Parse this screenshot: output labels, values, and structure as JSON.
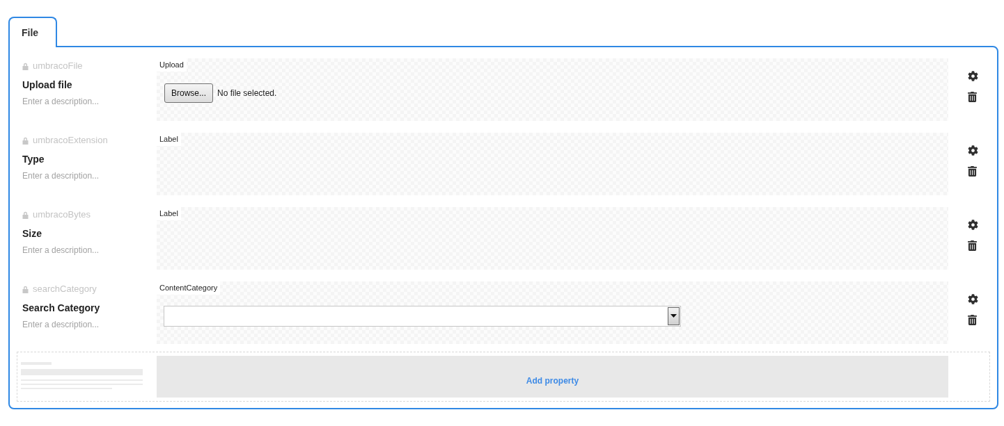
{
  "tabs": [
    {
      "label": "File",
      "selected": true
    }
  ],
  "properties": [
    {
      "alias": "umbracoFile",
      "locked": true,
      "name": "Upload file",
      "description": {
        "placeholder": "Enter a description..."
      },
      "editor": {
        "kind": "upload",
        "label": "Upload",
        "button": "Browse...",
        "status": "No file selected."
      }
    },
    {
      "alias": "umbracoExtension",
      "locked": true,
      "name": "Type",
      "description": {
        "placeholder": "Enter a description..."
      },
      "editor": {
        "kind": "label",
        "label": "Label"
      }
    },
    {
      "alias": "umbracoBytes",
      "locked": true,
      "name": "Size",
      "description": {
        "placeholder": "Enter a description..."
      },
      "editor": {
        "kind": "label",
        "label": "Label"
      }
    },
    {
      "alias": "searchCategory",
      "locked": true,
      "name": "Search Category",
      "description": {
        "placeholder": "Enter a description..."
      },
      "editor": {
        "kind": "dropdown",
        "label": "ContentCategory"
      }
    }
  ],
  "add_property": {
    "label": "Add property"
  }
}
